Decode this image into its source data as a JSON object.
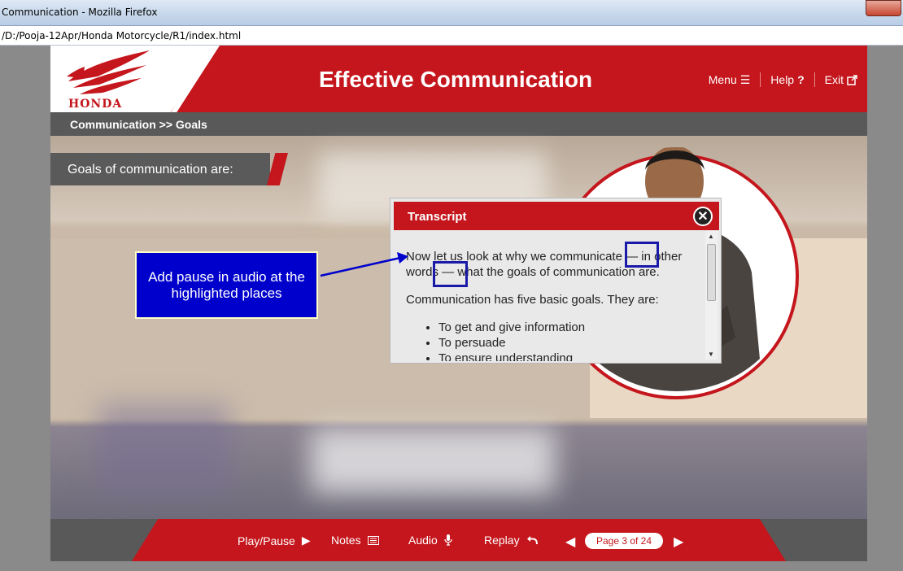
{
  "browser": {
    "window_title": "Communication - Mozilla Firefox",
    "url": "/D:/Pooja-12Apr/Honda Motorcycle/R1/index.html"
  },
  "header": {
    "brand": "HONDA",
    "title": "Effective Communication",
    "nav": [
      {
        "label": "Menu",
        "icon": "menu-icon"
      },
      {
        "label": "Help",
        "icon": "help-icon"
      },
      {
        "label": "Exit",
        "icon": "external-link-icon"
      }
    ]
  },
  "breadcrumb": "Communication >> Goals",
  "slide": {
    "heading": "Goals of communication are:"
  },
  "annotation": {
    "text": "Add pause in audio at the highlighted places"
  },
  "transcript": {
    "title": "Transcript",
    "close_icon": "close-icon",
    "paragraph1": "Now let us look at why we communicate — in other words — what the goals of communication are.",
    "paragraph2": "Communication has five basic goals. They are:",
    "bullets": [
      "To get and give information",
      "To persuade",
      "To ensure understanding"
    ]
  },
  "footer": {
    "play_pause": "Play/Pause",
    "notes": "Notes",
    "audio": "Audio",
    "replay": "Replay",
    "page_indicator": "Page 3 of 24"
  },
  "colors": {
    "brand_red": "#c4161c",
    "annotation_blue": "#0000cc",
    "dark_gray": "#595959"
  }
}
